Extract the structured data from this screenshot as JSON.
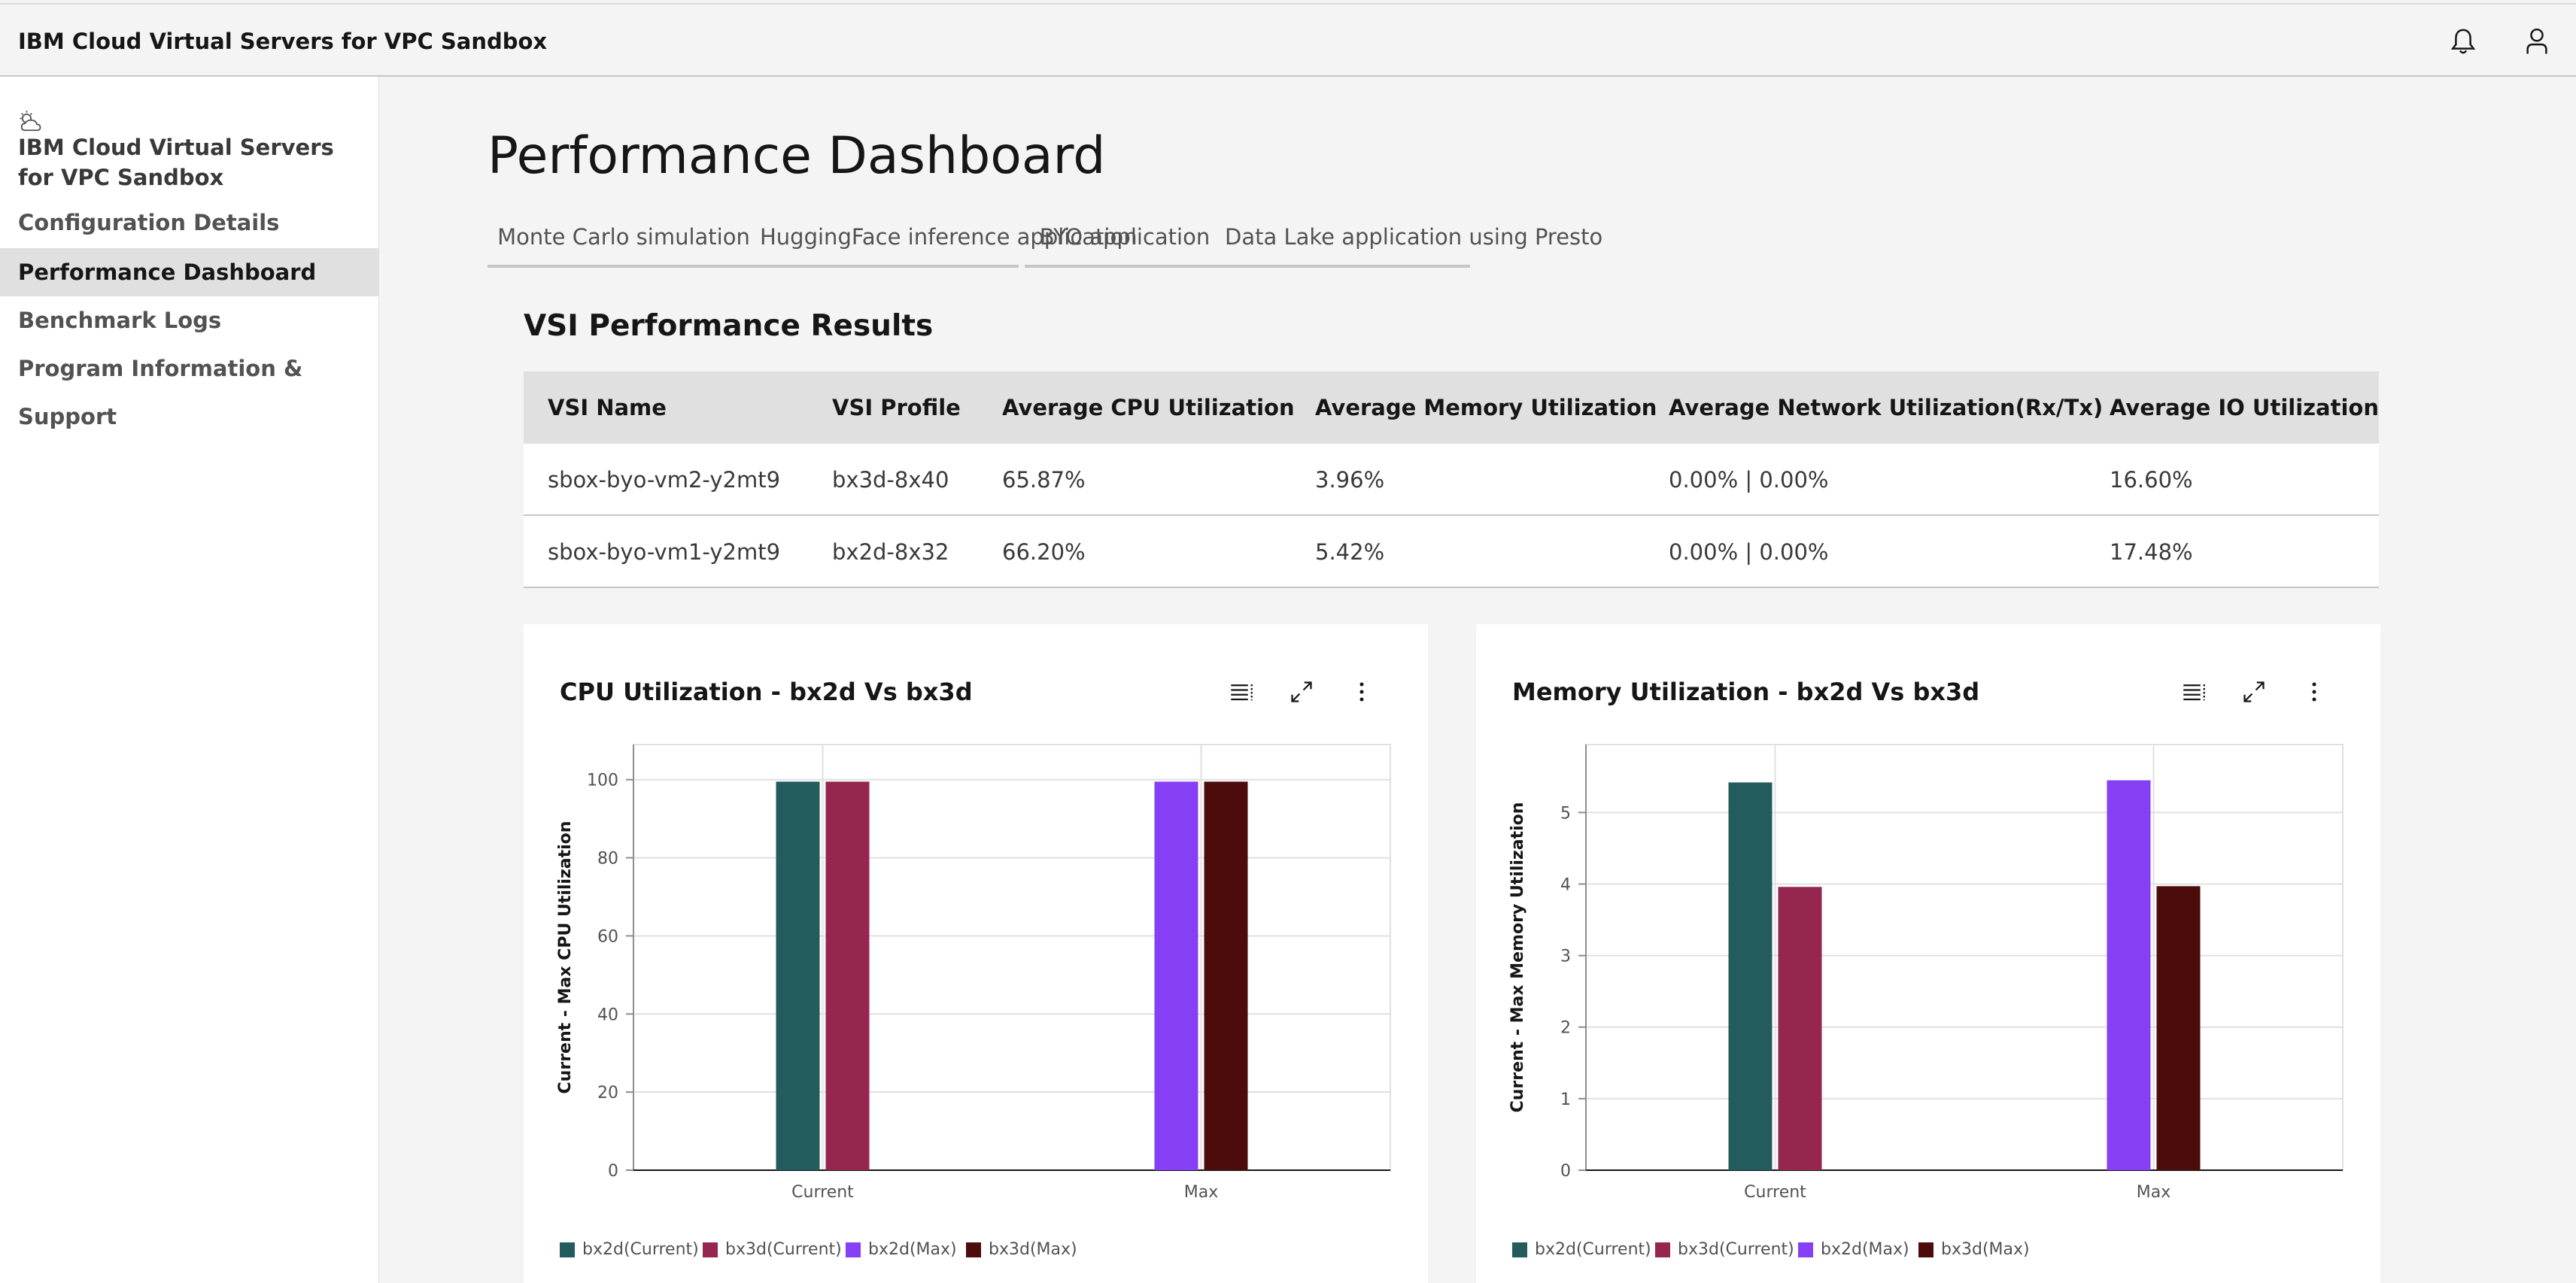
{
  "header": {
    "title": "IBM Cloud Virtual Servers for VPC Sandbox"
  },
  "icons": {
    "notification": "bell-icon",
    "user": "user-icon",
    "sidebar": "partly-cloudy-icon",
    "legend_toggle": "list-icon",
    "maximize": "maximize-icon",
    "overflow": "overflow-menu-icon"
  },
  "sidebar": {
    "heading": "IBM Cloud Virtual Servers for VPC Sandbox",
    "items": [
      {
        "label": "Configuration Details"
      },
      {
        "label": "Performance Dashboard"
      },
      {
        "label": "Benchmark Logs"
      },
      {
        "label": "Program Information & Support"
      }
    ]
  },
  "main": {
    "title": "Performance Dashboard",
    "tabs": [
      {
        "label": "Monte Carlo simulation"
      },
      {
        "label": "HuggingFace inference application"
      },
      {
        "label": "BYO application"
      },
      {
        "label": "Data Lake application using Presto"
      }
    ],
    "selected_tab": "BYO application",
    "section_title": "VSI Performance Results",
    "table": {
      "headers": [
        "VSI Name",
        "VSI Profile",
        "Average CPU Utilization",
        "Average Memory Utilization",
        "Average Network Utilization(Rx/Tx)",
        "Average IO Utilization"
      ],
      "rows": [
        [
          "sbox-byo-vm2-y2mt9",
          "bx3d-8x40",
          "65.87%",
          "3.96%",
          "0.00% | 0.00%",
          "16.60%"
        ],
        [
          "sbox-byo-vm1-y2mt9",
          "bx2d-8x32",
          "66.20%",
          "5.42%",
          "0.00% | 0.00%",
          "17.48%"
        ]
      ]
    }
  },
  "colors": {
    "bx2d_current": "#235c5c",
    "bx3d_current": "#952650",
    "bx2d_max": "#8540f5",
    "bx3d_max": "#4d0c0c",
    "tab_selected_border": "#0f62fe"
  },
  "chart_data": [
    {
      "type": "bar",
      "title": "CPU Utilization - bx2d Vs bx3d",
      "xlabel": "",
      "ylabel": "Current - Max CPU Utilization",
      "categories": [
        "Current",
        "Max"
      ],
      "series": [
        {
          "name": "bx2d(Current)",
          "values": [
            99.5,
            null
          ],
          "color": "#235c5c"
        },
        {
          "name": "bx3d(Current)",
          "values": [
            99.5,
            null
          ],
          "color": "#952650"
        },
        {
          "name": "bx2d(Max)",
          "values": [
            null,
            99.5
          ],
          "color": "#8540f5"
        },
        {
          "name": "bx3d(Max)",
          "values": [
            null,
            99.5
          ],
          "color": "#4d0c0c"
        }
      ],
      "yticks": [
        0,
        20,
        40,
        60,
        80,
        100
      ],
      "ylim": [
        0,
        109
      ],
      "grid": true,
      "legend": "bottom"
    },
    {
      "type": "bar",
      "title": "Memory Utilization - bx2d Vs bx3d",
      "xlabel": "",
      "ylabel": "Current - Max Memory Utilization",
      "categories": [
        "Current",
        "Max"
      ],
      "series": [
        {
          "name": "bx2d(Current)",
          "values": [
            5.42,
            null
          ],
          "color": "#235c5c"
        },
        {
          "name": "bx3d(Current)",
          "values": [
            3.96,
            null
          ],
          "color": "#952650"
        },
        {
          "name": "bx2d(Max)",
          "values": [
            null,
            5.45
          ],
          "color": "#8540f5"
        },
        {
          "name": "bx3d(Max)",
          "values": [
            null,
            3.97
          ],
          "color": "#4d0c0c"
        }
      ],
      "yticks": [
        0,
        1,
        2,
        3,
        4,
        5
      ],
      "ylim": [
        0,
        5.95
      ],
      "grid": true,
      "legend": "bottom"
    }
  ]
}
